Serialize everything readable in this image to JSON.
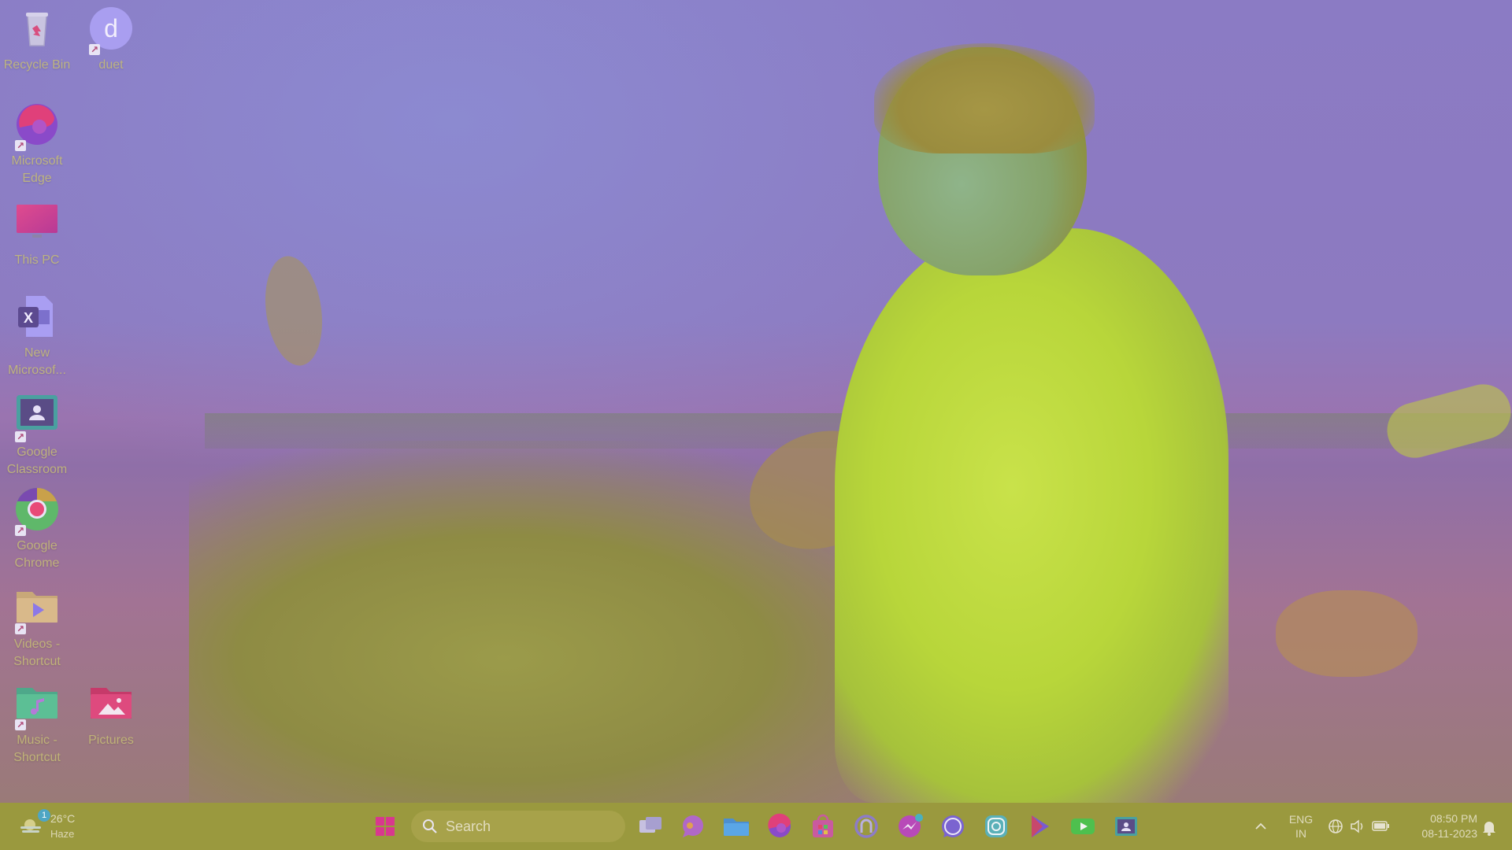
{
  "desktop": {
    "icons": [
      {
        "label": "Recycle Bin",
        "icon": "recycle-bin-icon"
      },
      {
        "label": "duet",
        "icon": "duet-icon",
        "letter": "d"
      },
      {
        "label": "Microsoft Edge",
        "icon": "edge-icon"
      },
      {
        "label": "This PC",
        "icon": "monitor-icon"
      },
      {
        "label": "New Microsof...",
        "icon": "excel-file-icon",
        "letter": "X"
      },
      {
        "label": "Google Classroom",
        "icon": "classroom-icon"
      },
      {
        "label": "Google Chrome",
        "icon": "chrome-icon"
      },
      {
        "label": "Videos - Shortcut",
        "icon": "videos-folder-icon"
      },
      {
        "label": "Music - Shortcut",
        "icon": "music-folder-icon"
      },
      {
        "label": "Pictures",
        "icon": "pictures-folder-icon"
      }
    ]
  },
  "taskbar": {
    "weather": {
      "temp": "26°C",
      "condition": "Haze",
      "badge": "1"
    },
    "search": {
      "placeholder": "Search"
    },
    "pinned": [
      {
        "name": "start-button",
        "icon": "windows-icon"
      },
      {
        "name": "task-view",
        "icon": "task-view-icon"
      },
      {
        "name": "chat",
        "icon": "chat-icon"
      },
      {
        "name": "file-explorer",
        "icon": "folder-icon"
      },
      {
        "name": "edge",
        "icon": "edge-icon"
      },
      {
        "name": "store",
        "icon": "store-icon"
      },
      {
        "name": "copilot",
        "icon": "copilot-icon"
      },
      {
        "name": "messenger",
        "icon": "messenger-icon"
      },
      {
        "name": "whatsapp",
        "icon": "whatsapp-icon"
      },
      {
        "name": "instagram",
        "icon": "instagram-icon"
      },
      {
        "name": "play-store",
        "icon": "play-store-icon"
      },
      {
        "name": "youtube",
        "icon": "youtube-icon"
      },
      {
        "name": "classroom",
        "icon": "classroom-icon"
      }
    ],
    "tray": {
      "lang_line1": "ENG",
      "lang_line2": "IN",
      "time": "08:50 PM",
      "date": "08-11-2023"
    }
  },
  "colors": {
    "taskbar_bg": "#9a993e",
    "desktop_tint": "#8b7bc4"
  }
}
